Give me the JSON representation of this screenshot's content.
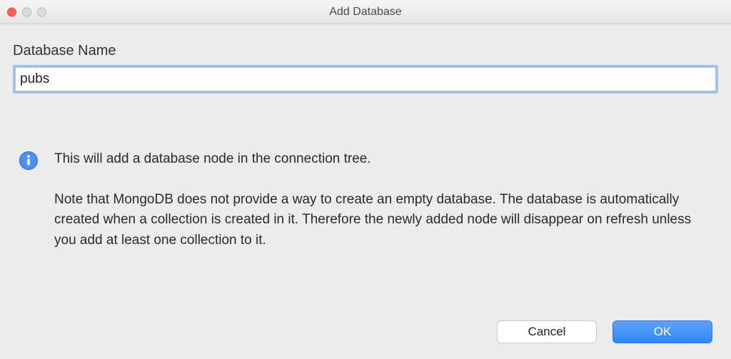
{
  "window": {
    "title": "Add Database"
  },
  "form": {
    "label": "Database Name",
    "value": "pubs",
    "placeholder": ""
  },
  "info": {
    "line1": "This will add a database node in the connection tree.",
    "line2": "Note that MongoDB does not provide a way to create an empty database. The database is automatically created when a collection is created in it. Therefore the newly added node will disappear on refresh unless you add at least one collection to it."
  },
  "buttons": {
    "cancel": "Cancel",
    "ok": "OK"
  },
  "colors": {
    "focusRing": "#9cc3ee",
    "primaryButton": "#2f86f6"
  }
}
